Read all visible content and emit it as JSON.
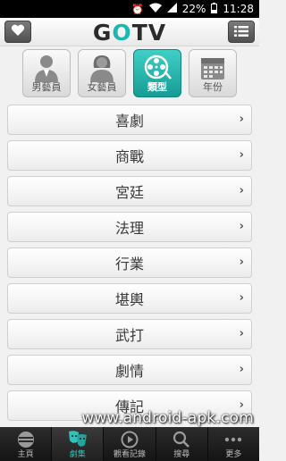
{
  "status_bar": {
    "battery": "22%",
    "time": "11:28"
  },
  "header": {
    "logo_prefix": "G",
    "logo_accent": "O",
    "logo_suffix": "TV"
  },
  "categories": [
    {
      "label": "男藝員",
      "icon": "male-actor-icon",
      "active": false
    },
    {
      "label": "女藝員",
      "icon": "female-actor-icon",
      "active": false
    },
    {
      "label": "類型",
      "icon": "film-reel-icon",
      "active": true
    },
    {
      "label": "年份",
      "icon": "calendar-icon",
      "active": false
    }
  ],
  "genres": [
    {
      "label": "喜劇"
    },
    {
      "label": "商戰"
    },
    {
      "label": "宮廷"
    },
    {
      "label": "法理"
    },
    {
      "label": "行業"
    },
    {
      "label": "堪輿"
    },
    {
      "label": "武打"
    },
    {
      "label": "劇情"
    },
    {
      "label": "傳記"
    }
  ],
  "watermark": "www.android-apk.com",
  "bottom_nav": [
    {
      "label": "主頁",
      "icon": "home-disc-icon",
      "active": false
    },
    {
      "label": "劇集",
      "icon": "drama-masks-icon",
      "active": true
    },
    {
      "label": "觀看記錄",
      "icon": "history-play-icon",
      "active": false
    },
    {
      "label": "搜尋",
      "icon": "search-icon",
      "active": false
    },
    {
      "label": "更多",
      "icon": "more-dots-icon",
      "active": false
    }
  ],
  "colors": {
    "accent": "#1bb7b2",
    "header_bg": "#f4f4f4",
    "nav_bg": "#1e1e1e"
  }
}
